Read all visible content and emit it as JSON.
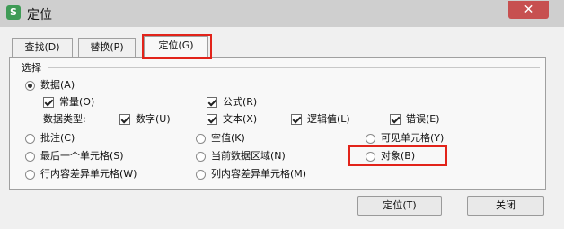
{
  "window": {
    "title": "定位",
    "app_icon_letter": "S",
    "close_glyph": "✕"
  },
  "tabs": [
    {
      "label": "查找(D)"
    },
    {
      "label": "替换(P)"
    },
    {
      "label": "定位(G)",
      "selected": true
    }
  ],
  "group": {
    "title": "选择"
  },
  "options": {
    "data": {
      "label": "数据(A)",
      "selected": true
    },
    "constant": {
      "label": "常量(O)",
      "checked": true
    },
    "formula": {
      "label": "公式(R)",
      "checked": true
    },
    "data_type_label": "数据类型:",
    "number": {
      "label": "数字(U)",
      "checked": true
    },
    "text": {
      "label": "文本(X)",
      "checked": true
    },
    "logic": {
      "label": "逻辑值(L)",
      "checked": true
    },
    "error": {
      "label": "错误(E)",
      "checked": true
    },
    "comment": {
      "label": "批注(C)",
      "selected": false
    },
    "blank": {
      "label": "空值(K)",
      "selected": false
    },
    "visible_cells": {
      "label": "可见单元格(Y)",
      "selected": false
    },
    "last_cell": {
      "label": "最后一个单元格(S)",
      "selected": false
    },
    "current_region": {
      "label": "当前数据区域(N)",
      "selected": false
    },
    "object": {
      "label": "对象(B)",
      "selected": false
    },
    "row_diff": {
      "label": "行内容差异单元格(W)",
      "selected": false
    },
    "col_diff": {
      "label": "列内容差异单元格(M)",
      "selected": false
    }
  },
  "buttons": {
    "locate": "定位(T)",
    "close": "关闭"
  },
  "colors": {
    "highlight": "#e2231a",
    "close_button": "#c75050"
  }
}
